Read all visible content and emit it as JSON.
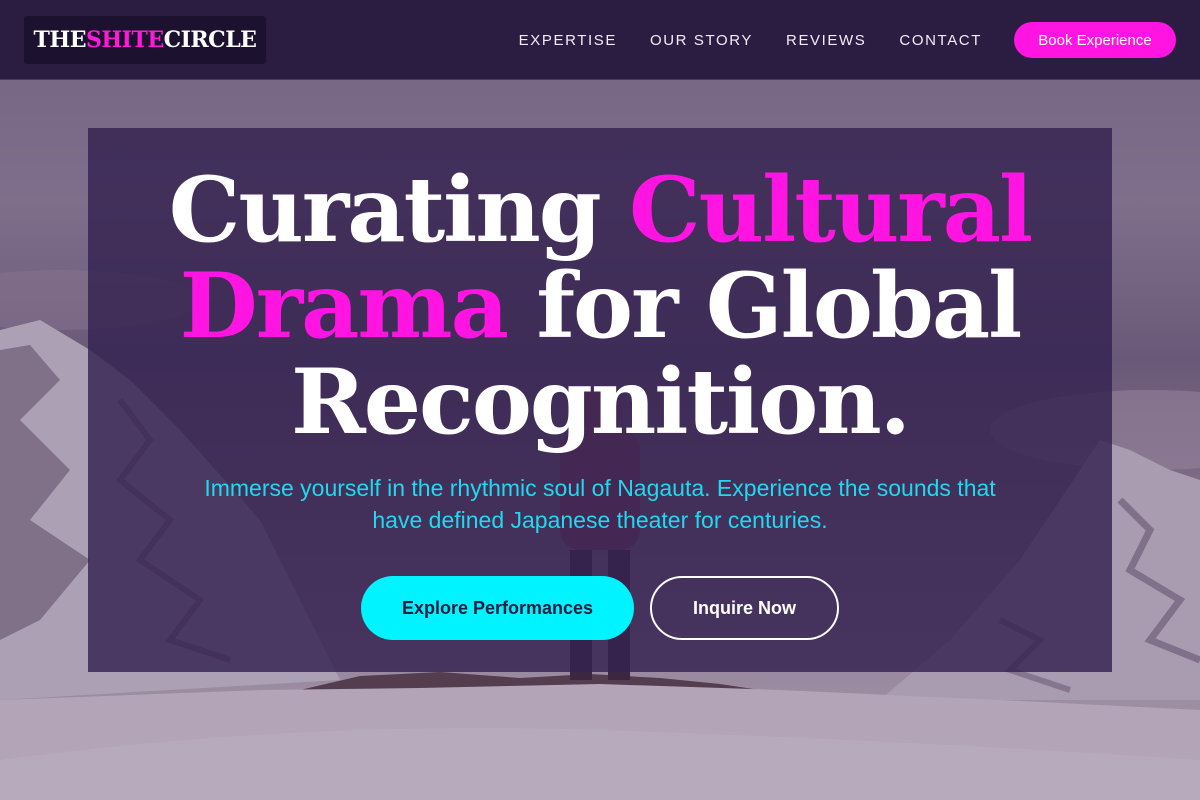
{
  "header": {
    "logo": {
      "part1": "THE ",
      "accent": "SHITE",
      "part2": " CIRCLE"
    },
    "nav": [
      "EXPERTISE",
      "OUR STORY",
      "REVIEWS",
      "CONTACT"
    ],
    "cta_label": "Book Experience"
  },
  "hero": {
    "headline": {
      "part1": "Curating ",
      "pink1": "Cultural",
      "pink2": "Drama",
      "part2": " for Global",
      "part3": "Recognition."
    },
    "subtext": "Immerse yourself in the rhythmic soul of Nagauta. Experience the sounds that have defined Japanese theater for centuries.",
    "primary_button": "Explore Performances",
    "secondary_button": "Inquire Now"
  },
  "colors": {
    "header_bg": "#2b1c42",
    "accent_pink": "#ff14e2",
    "accent_cyan": "#00f4ff",
    "subtext_cyan": "#22d8ee",
    "card_bg": "rgba(52,34,80,0.82)"
  }
}
